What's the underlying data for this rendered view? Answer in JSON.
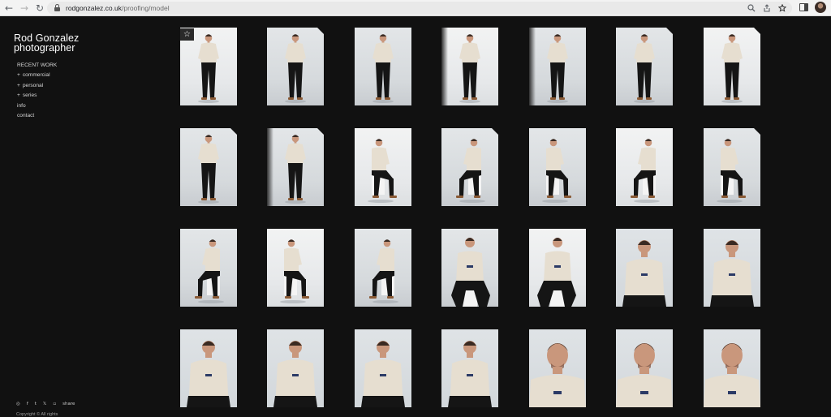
{
  "browser": {
    "back_icon": "←",
    "forward_icon": "→",
    "reload_icon": "↻",
    "url_host": "rodgonzalez.co.uk",
    "url_path": "/proofing/model"
  },
  "site": {
    "brand_line1": "Rod Gonzalez",
    "brand_line2": "photographer",
    "menu": [
      {
        "label": "RECENT WORK",
        "plus": ""
      },
      {
        "label": "commercial",
        "plus": "+"
      },
      {
        "label": "personal",
        "plus": "+"
      },
      {
        "label": "series",
        "plus": "+"
      },
      {
        "label": "info",
        "plus": ""
      },
      {
        "label": "contact",
        "plus": ""
      }
    ],
    "social": [
      "◎",
      "f",
      "t",
      "𝕏",
      "▫",
      "share"
    ],
    "copyright": "Copyright © All rights"
  },
  "gallery": {
    "favorite_icon": "☆",
    "rows": [
      [
        "standing",
        "standing",
        "standing",
        "standing",
        "standing",
        "standing",
        "standing"
      ],
      [
        "standing",
        "standing",
        "seated",
        "seated",
        "seated",
        "seated",
        "seated"
      ],
      [
        "seated",
        "seated",
        "seated",
        "seated-close",
        "seated-close",
        "half-body",
        "half-body"
      ],
      [
        "half-body",
        "half-body",
        "half-body",
        "half-body",
        "portrait",
        "portrait",
        "portrait"
      ]
    ]
  }
}
